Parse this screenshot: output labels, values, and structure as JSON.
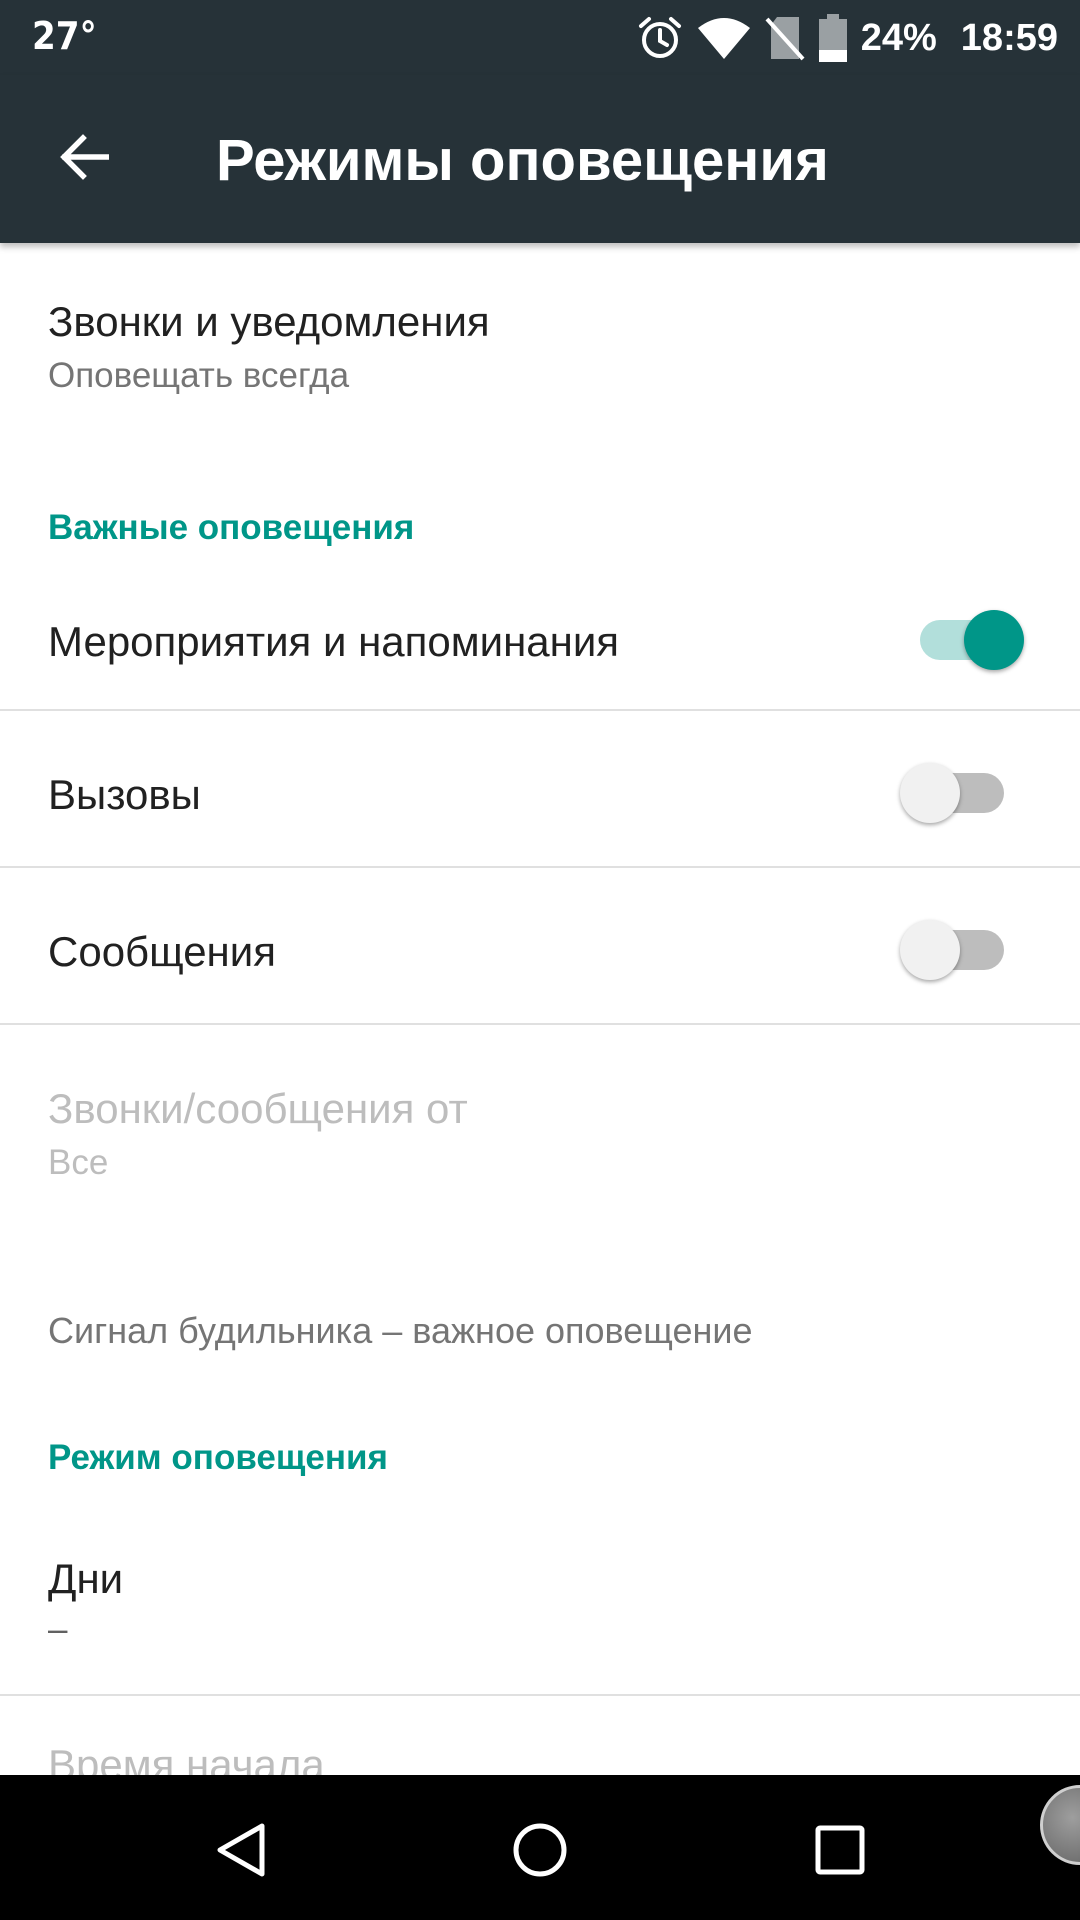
{
  "status_bar": {
    "temperature": "27°",
    "battery_percent": "24%",
    "time": "18:59",
    "icons": [
      "alarm-icon",
      "wifi-icon",
      "no-sim-icon",
      "battery-icon"
    ]
  },
  "app_bar": {
    "title": "Режимы оповещения",
    "back_icon": "arrow-left-icon"
  },
  "calls_notifications": {
    "title": "Звонки и уведомления",
    "summary": "Оповещать всегда"
  },
  "important_section": {
    "header": "Важные оповещения",
    "items": [
      {
        "title": "Мероприятия и напоминания",
        "enabled": true
      },
      {
        "title": "Вызовы",
        "enabled": false
      },
      {
        "title": "Сообщения",
        "enabled": false
      }
    ]
  },
  "calls_messages_from": {
    "title": "Звонки/сообщения от",
    "summary": "Все"
  },
  "alarm_info": "Сигнал будильника – важное оповещение",
  "mode_section": {
    "header": "Режим оповещения",
    "days_title": "Дни",
    "days_summary": "–",
    "start_time_title": "Время начала"
  },
  "nav_bar": {
    "buttons": [
      "back-triangle-icon",
      "home-circle-icon",
      "recents-square-icon"
    ]
  },
  "colors": {
    "toolbar": "#263238",
    "accent": "#009688",
    "accent_light": "#b2dfdb"
  }
}
